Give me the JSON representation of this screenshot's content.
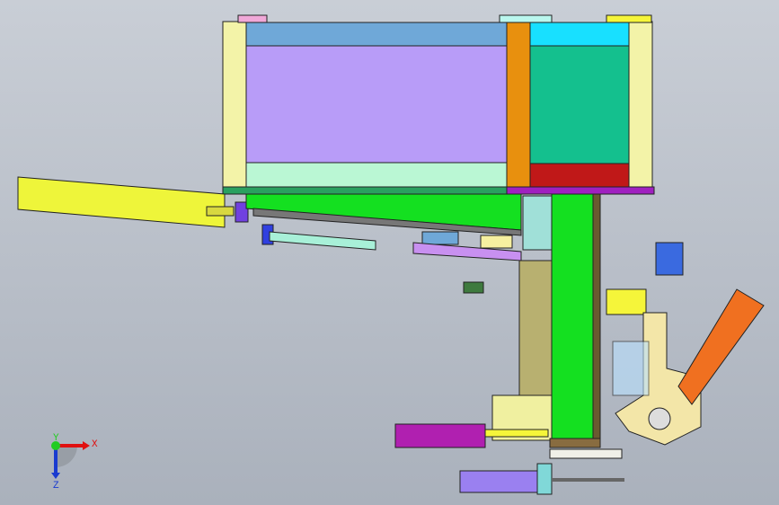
{
  "triad": {
    "x_label": "X",
    "y_label": "Y",
    "z_label": "Z"
  },
  "colors": {
    "x_axis": "#e01010",
    "y_axis": "#22cc22",
    "z_axis": "#1a3bd0"
  }
}
